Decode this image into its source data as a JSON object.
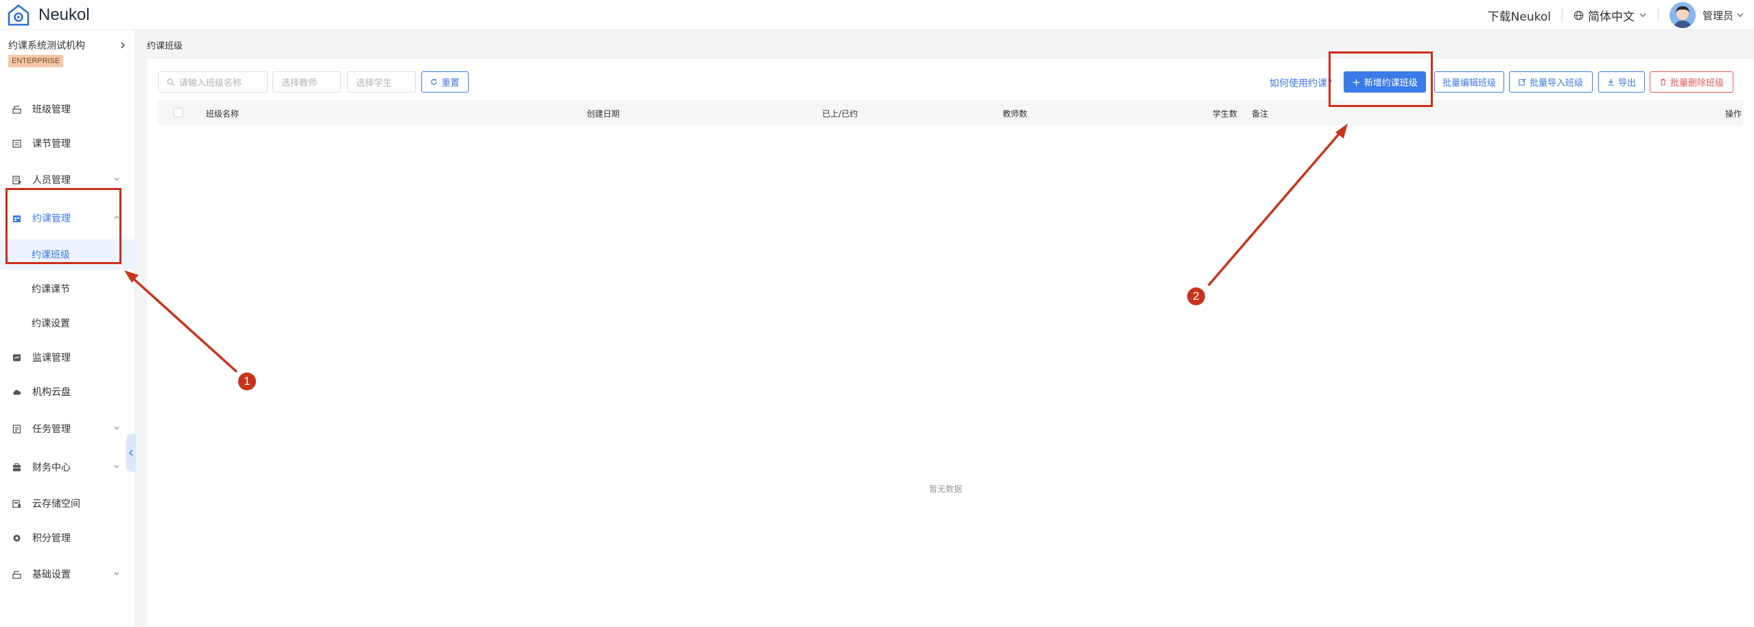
{
  "app": {
    "name": "Neukol"
  },
  "topbar": {
    "download_label": "下载Neukol",
    "language": "简体中文",
    "user": "管理员"
  },
  "sidebar": {
    "org_name": "约课系统测试机构",
    "badge": "ENTERPRISE",
    "items": [
      {
        "label": "班级管理"
      },
      {
        "label": "课节管理"
      },
      {
        "label": "人员管理"
      },
      {
        "label": "约课管理"
      },
      {
        "label": "约课班级"
      },
      {
        "label": "约课课节"
      },
      {
        "label": "约课设置"
      },
      {
        "label": "监课管理"
      },
      {
        "label": "机构云盘"
      },
      {
        "label": "任务管理"
      },
      {
        "label": "财务中心"
      },
      {
        "label": "云存储空间"
      },
      {
        "label": "积分管理"
      },
      {
        "label": "基础设置"
      }
    ]
  },
  "breadcrumb": "约课班级",
  "filters": {
    "class_placeholder": "请输入班级名称",
    "teacher_placeholder": "选择教师",
    "student_placeholder": "选择学生",
    "reset_label": "重置"
  },
  "toolbar": {
    "help_label": "如何使用约课?",
    "add_label": "新增约课班级",
    "batch_edit_label": "批量编辑班级",
    "batch_import_label": "批量导入班级",
    "export_label": "导出",
    "batch_delete_label": "批量删除班级"
  },
  "table": {
    "columns": [
      "班级名称",
      "创建日期",
      "已上/已约",
      "教师数",
      "学生数",
      "备注",
      "操作"
    ],
    "empty_text": "暂无数据"
  },
  "annotations": {
    "step1": "1",
    "step2": "2"
  },
  "colors": {
    "primary": "#3a7be8",
    "danger": "#e35a5a",
    "annotation": "#cc2e1b"
  }
}
